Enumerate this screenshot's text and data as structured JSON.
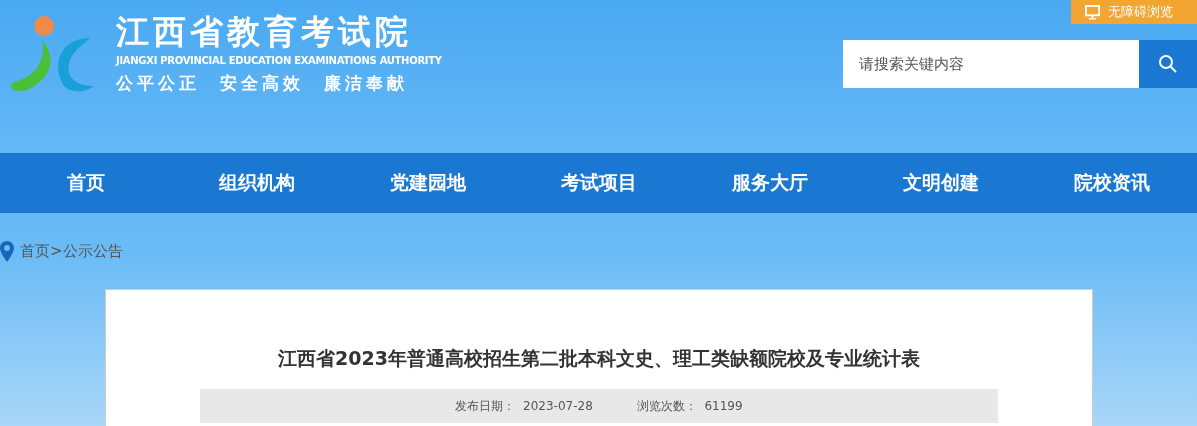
{
  "header": {
    "title": "江西省教育考试院",
    "subtitle": "JIANGXI PROVINCIAL EDUCATION EXAMINATIONS AUTHORITY",
    "slogan": "公平公正  安全高效  廉洁奉献",
    "accessibility": "无障碍浏览",
    "search": {
      "placeholder": "请搜索关键内容"
    }
  },
  "nav": [
    "首页",
    "组织机构",
    "党建园地",
    "考试项目",
    "服务大厅",
    "文明创建",
    "院校资讯"
  ],
  "breadcrumb": {
    "items": [
      "首页",
      "公示公告"
    ],
    "separator": ">"
  },
  "article": {
    "title": "江西省2023年普通高校招生第二批本科文史、理工类缺额院校及专业统计表",
    "meta": [
      {
        "label": "发布日期：",
        "value": "2023-07-28"
      },
      {
        "label": "浏览次数：",
        "value": "61199"
      }
    ]
  }
}
